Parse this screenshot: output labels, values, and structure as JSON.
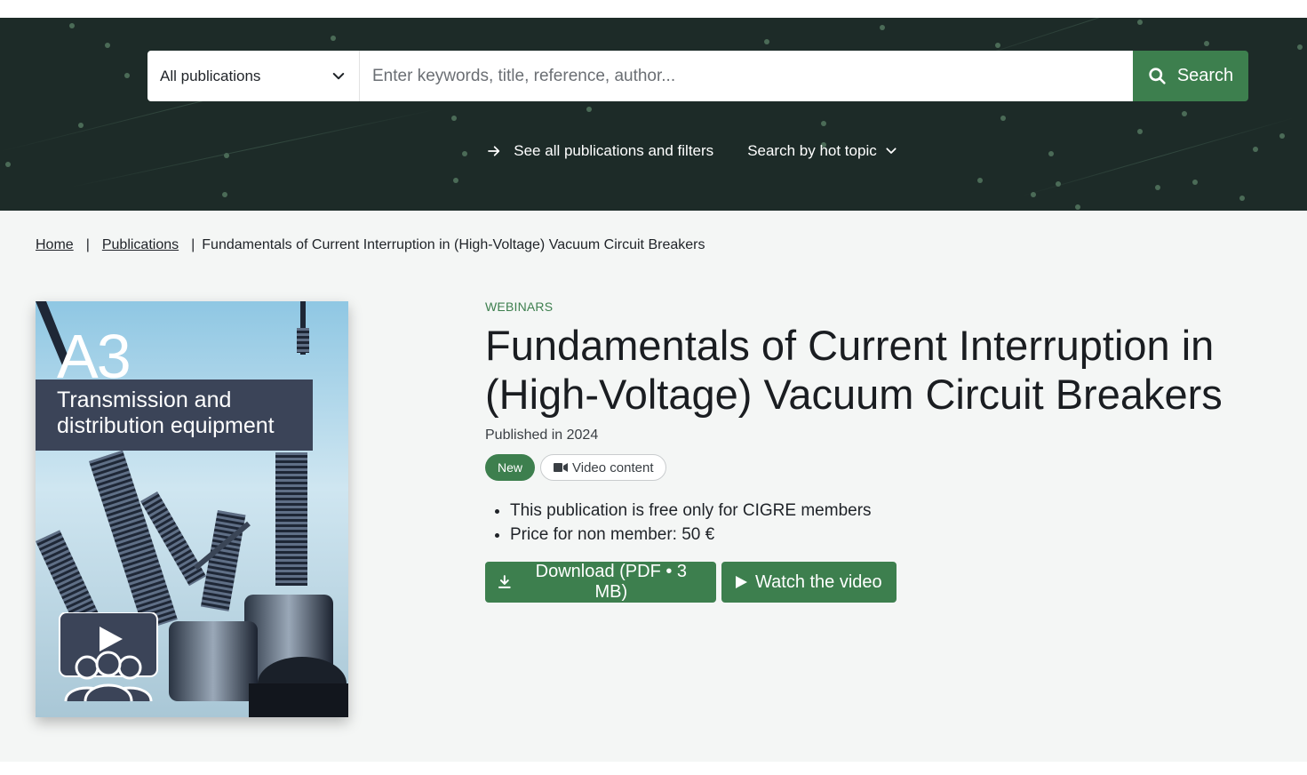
{
  "search": {
    "scope_selected": "All publications",
    "placeholder": "Enter keywords, title, reference, author...",
    "button_label": "Search"
  },
  "hero_links": {
    "see_all": "See all publications and filters",
    "hot_topic": "Search by hot topic"
  },
  "breadcrumb": {
    "home": "Home",
    "separator": "|",
    "publications": "Publications",
    "current": "Fundamentals of Current Interruption in (High-Voltage) Vacuum Circuit Breakers"
  },
  "cover": {
    "code": "A3",
    "title_line1": "Transmission and",
    "title_line2": "distribution equipment"
  },
  "publication": {
    "category": "WEBINARS",
    "title": "Fundamentals of Current Interruption in (High-Voltage) Vacuum Circuit Breakers",
    "published": "Published in 2024",
    "badge_new": "New",
    "badge_video": "Video content",
    "info": [
      "This publication is free only for CIGRE members",
      "Price for non member: 50 €"
    ],
    "download_label": "Download (PDF • 3 MB)",
    "watch_label": "Watch the video"
  },
  "colors": {
    "hero_bg": "#1d2b28",
    "accent_green": "#3d7f4e",
    "page_bg": "#f4f6f5",
    "cover_band": "#3b4458"
  },
  "icons": [
    "chevron-down-icon",
    "search-icon",
    "arrow-right-icon",
    "video-camera-icon",
    "download-icon",
    "play-icon",
    "webinar-icon"
  ]
}
